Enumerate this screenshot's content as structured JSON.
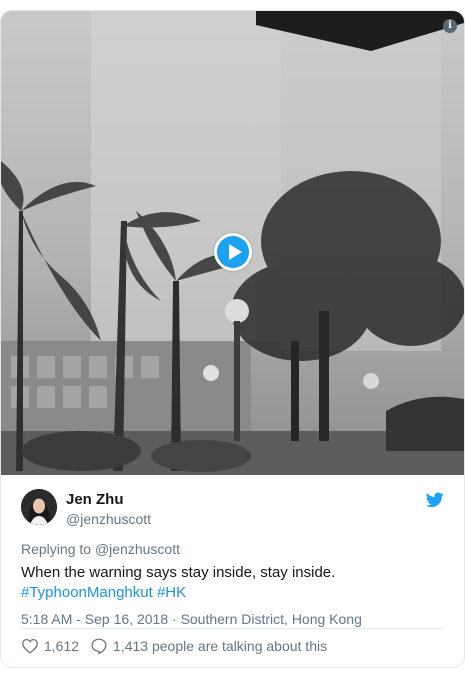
{
  "tweet": {
    "author_name": "Jen Zhu",
    "author_handle": "@jenzhuscott",
    "reply_prefix": "Replying to",
    "reply_to": "@jenzhuscott",
    "text_line": "When the warning says stay inside, stay inside.",
    "hashtags": [
      "#TyphoonManghkut",
      "#HK"
    ],
    "timestamp": "5:18 AM - Sep 16, 2018",
    "separator": "·",
    "location": "Southern District, Hong Kong",
    "likes": "1,612",
    "talking": "1,413 people are talking about this"
  },
  "colors": {
    "twitter_blue": "#1da1f2",
    "link_blue": "#1b95e0",
    "muted": "#657786",
    "border": "#e1e8ed"
  },
  "icons": {
    "play": "play-icon",
    "info": "info-icon",
    "brand": "twitter-bird-icon",
    "like": "heart-icon",
    "reply": "speech-bubble-icon"
  }
}
